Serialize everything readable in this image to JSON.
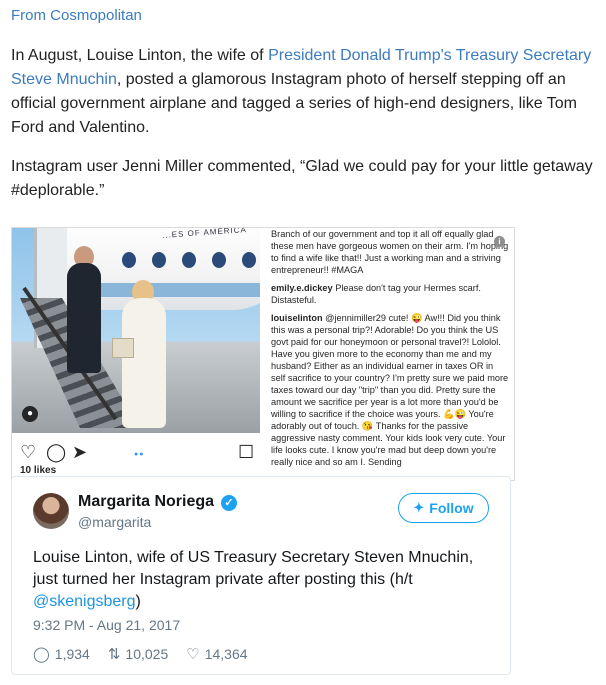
{
  "source": {
    "label": "From Cosmopolitan"
  },
  "paragraph1": {
    "before": "In August, Louise Linton, the wife of ",
    "link": "President Donald Trump's Treasury Secretary Steve Mnuchin",
    "after": ", posted a glamorous Instagram photo of herself stepping off an official government airplane and tagged a series of high-end designers, like Tom Ford and Valentino."
  },
  "paragraph2": "Instagram user Jenni Miller commented, “Glad we could pay for your little getaway #deplorable.”",
  "instagram": {
    "plane_text": "...ES OF AMERICA",
    "likes": "10 likes",
    "icons": [
      "heart-icon",
      "comment-icon",
      "share-icon",
      "bookmark-icon"
    ],
    "comments": [
      {
        "user": "",
        "text": "Branch of our government and top it all off equally glad these men have gorgeous women on their arm. I'm hoping to find a wife like that!! Just a working man and a striving entrepreneur!! #MAGA"
      },
      {
        "user": "emily.e.dickey",
        "text": " Please don't tag your Hermes scarf. Distasteful."
      },
      {
        "user": "louiselinton",
        "text": " @jennimiller29 cute! 😜 Aw!!! Did you think this was a personal trip?! Adorable! Do you think the US govt paid for our honeymoon or personal travel?! Lololol. Have you given more to the economy than me and my husband? Either as an individual earner in taxes OR in self sacrifice to your country? I'm pretty sure we paid more taxes toward our day \"trip\" than you did. Pretty sure the amount we sacrifice per year is a lot more than you'd be willing to sacrifice if the choice was yours. 💪😜 You're adorably out of touch. 😘 Thanks for the passive aggressive nasty comment. Your kids look very cute. Your life looks cute. I know you're mad but deep down you're really nice and so am I. Sending"
      }
    ]
  },
  "tweet": {
    "display_name": "Margarita Noriega",
    "handle": "@margarita",
    "follow_label": "Follow",
    "text": "Louise Linton, wife of US Treasury Secretary Steven Mnuchin, just turned her Instagram private after posting this (h/t ",
    "mention": "@skenigsberg",
    "text_end": ")",
    "timestamp": "9:32 PM - Aug 21, 2017",
    "replies": "1,934",
    "retweets": "10,025",
    "likes": "14,364"
  },
  "colors": {
    "link": "#3b7bbf",
    "twitter_blue": "#1da1f2"
  }
}
